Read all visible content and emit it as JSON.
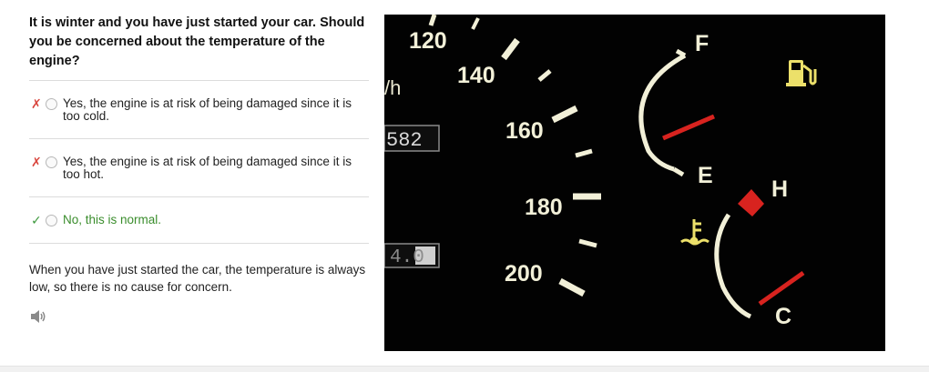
{
  "question": "It is winter and you have just started your car. Should you be concerned about the temperature of the engine?",
  "options": [
    {
      "mark": "✗",
      "status": "wrong",
      "text": "Yes, the engine is at risk of being damaged since it is too cold."
    },
    {
      "mark": "✗",
      "status": "wrong",
      "text": "Yes, the engine is at risk of being damaged since it is too hot."
    },
    {
      "mark": "✓",
      "status": "correct",
      "text": "No, this is normal."
    }
  ],
  "explanation": "When you have just started the car, the temperature is always low, so there is no cause for concern.",
  "speaker_icon": "speaker-icon",
  "dashboard": {
    "speed_labels": [
      "120",
      "140",
      "160",
      "180",
      "200"
    ],
    "unit_fragment": "/h",
    "odometer": "582",
    "trip": "4.0",
    "fuel_full": "F",
    "fuel_empty": "E",
    "temp_hot": "H",
    "temp_cold": "C",
    "fuel_icon": "fuel-pump-icon",
    "coolant_icon": "coolant-temperature-icon"
  },
  "colors": {
    "wrong": "#d9463e",
    "correct": "#3a8d2c",
    "gauge_text": "#f2f0d8",
    "needle": "#d8231f"
  }
}
